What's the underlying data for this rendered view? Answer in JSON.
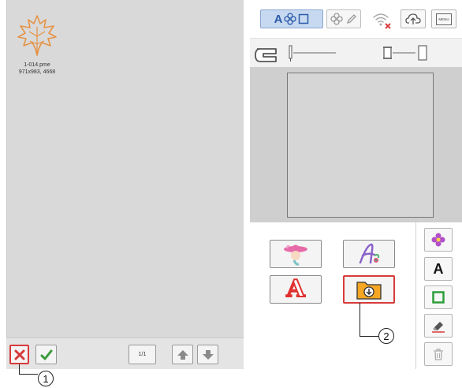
{
  "file": {
    "name": "1-014.pme",
    "size": "971x983, 4668"
  },
  "left_toolbar": {
    "page_counter": "1/1"
  },
  "top_bar": {
    "menu_label": "MENU"
  },
  "side_toolbar": {
    "text_tool_label": "A"
  },
  "callouts": {
    "one": "1",
    "two": "2"
  },
  "colors": {
    "accent_red": "#d83a3a",
    "check_green": "#3a9a3a",
    "folder_orange": "#f5a623",
    "leaf_orange": "#e59345",
    "toolbar_blue": "#c7d9f1"
  },
  "icons": {
    "cancel": "x-icon",
    "ok": "checkmark-icon",
    "up": "arrow-up-icon",
    "down": "arrow-down-icon",
    "wifi": "wifi-disconnected-icon",
    "folder": "folder-download-icon",
    "trash": "trash-icon"
  }
}
